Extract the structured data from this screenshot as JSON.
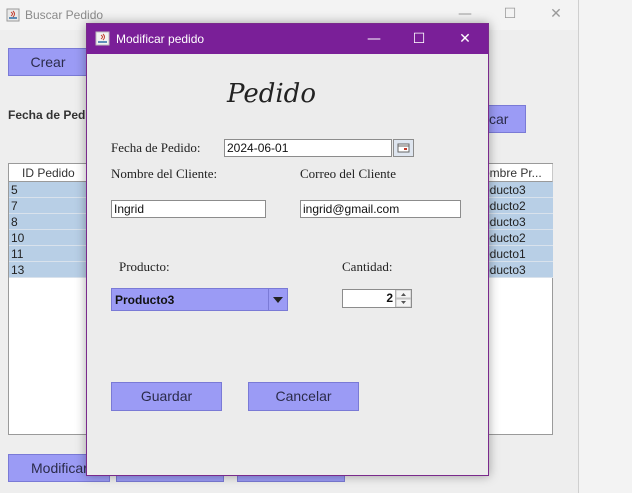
{
  "background_window": {
    "title": "Buscar Pedido",
    "create_button": "Crear",
    "date_label": "Fecha de Pedido",
    "search_button": "car",
    "bottom_button": "Modificar",
    "table": {
      "columns": [
        "ID Pedido",
        "ombre Pr..."
      ],
      "rows": [
        {
          "id": "5",
          "product": "oducto3"
        },
        {
          "id": "7",
          "product": "oducto2"
        },
        {
          "id": "8",
          "product": "oducto3"
        },
        {
          "id": "10",
          "product": "oducto2"
        },
        {
          "id": "11",
          "product": "oducto1"
        },
        {
          "id": "13",
          "product": "oducto3"
        }
      ]
    }
  },
  "dialog": {
    "title": "Modificar pedido",
    "heading": "Pedido",
    "date_label": "Fecha de Pedido:",
    "date_value": "2024-06-01",
    "client_name_label": "Nombre del Cliente:",
    "client_name_value": "Ingrid",
    "client_email_label": "Correo del Cliente",
    "client_email_value": "ingrid@gmail.com",
    "product_label": "Producto:",
    "product_value": "Producto3",
    "quantity_label": "Cantidad:",
    "quantity_value": "2",
    "save_button": "Guardar",
    "cancel_button": "Cancelar"
  },
  "colors": {
    "accent": "#9b9bf5",
    "dialog_titlebar": "#7a1f98",
    "table_selection": "#b8cfe6"
  }
}
